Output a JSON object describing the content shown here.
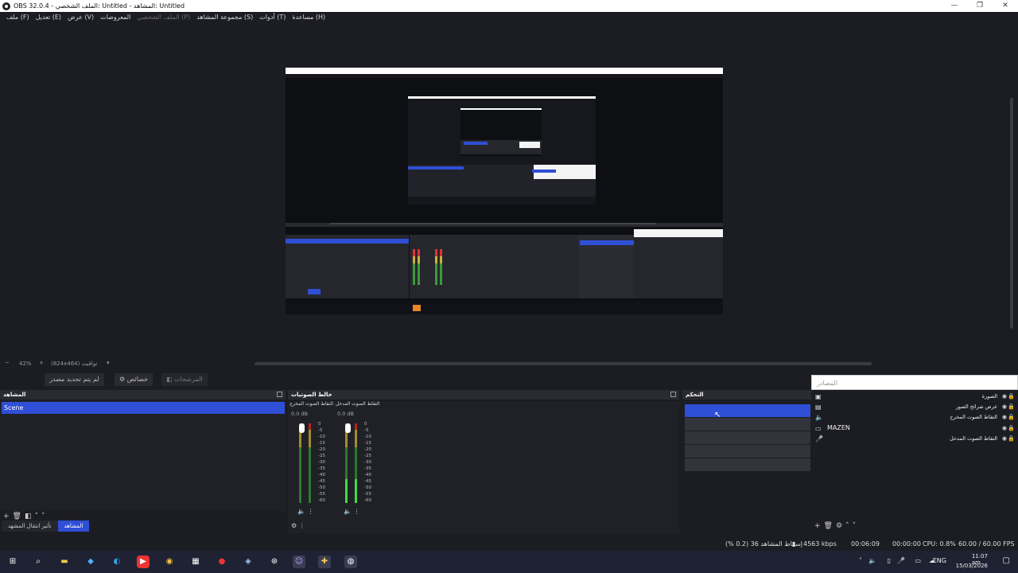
{
  "window": {
    "title": "OBS 32.0.4 - الملف الشخصي: Untitled - المشاهد: Untitled",
    "minimize": "—",
    "maximize": "❐",
    "close": "✕"
  },
  "menu": [
    {
      "label": "ملف (F)",
      "dim": false
    },
    {
      "label": "تعديل (E)",
      "dim": false
    },
    {
      "label": "عرض (V)",
      "dim": false
    },
    {
      "label": "المعروضات",
      "dim": false
    },
    {
      "label": "الملف الشخصي (P)",
      "dim": true
    },
    {
      "label": "مجموعة المشاهد (S)",
      "dim": false
    },
    {
      "label": "أدوات (T)",
      "dim": false
    },
    {
      "label": "مساعدة (H)",
      "dim": false
    }
  ],
  "zoom": {
    "minus": "−",
    "value": "42%",
    "plus": "+",
    "canvas": "(824x464) تواقيت",
    "dropdown": "▾"
  },
  "dock_tabs": {
    "no_source": "لم يتم تحديد مصدر",
    "properties": "خصائص",
    "filters": "المرشحات"
  },
  "sources_search_placeholder": "المصادر",
  "scenes": {
    "title": "المشاهد",
    "items": [
      "Scene"
    ],
    "footer_tabs": {
      "transitions": "تأثير انتقال المشهد",
      "scenes": "المشاهد"
    }
  },
  "mixer": {
    "title": "خالط الصوتيات",
    "channels": [
      {
        "name": "التقاط الصوت المخرج",
        "db": "0.0 dB"
      },
      {
        "name": "التقاط الصوت المدخل",
        "db": "0.0 dB"
      }
    ],
    "scale": [
      "0",
      "-5",
      "-10",
      "-15",
      "-20",
      "-25",
      "-30",
      "-35",
      "-40",
      "-45",
      "-50",
      "-55",
      "-60"
    ]
  },
  "controls": {
    "title": "التحكم"
  },
  "sources": {
    "items": [
      {
        "label": "الصورة",
        "icon": "image-icon"
      },
      {
        "label": "عرض شرائح الصور",
        "icon": "slideshow-icon"
      },
      {
        "label": "التقاط الصوت المخرج",
        "icon": "speaker-icon"
      },
      {
        "label": "MAZEN",
        "icon": "monitor-icon"
      },
      {
        "label": "التقاط الصوت المدخل",
        "icon": "microphone-icon"
      }
    ]
  },
  "status": {
    "dropped_frames": "إسقاط المشاهد 36 (0.2 %)",
    "bitrate": "4563 kbps",
    "stream_time": "00:06:09",
    "record_time": "00:00:00",
    "cpu": "CPU: 0.8%",
    "fps": "60.00 / 60.00 FPS"
  },
  "taskbar": {
    "lang": "ENG",
    "time": "11:07 am",
    "date": "15/03/2026"
  },
  "colors": {
    "accent": "#2f4fd6",
    "background": "#1c1d23"
  }
}
